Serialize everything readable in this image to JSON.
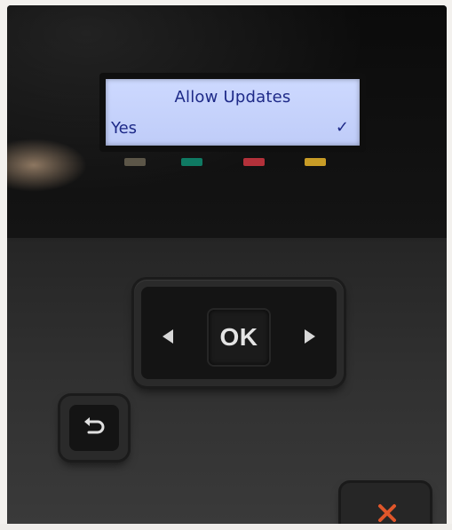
{
  "display": {
    "title": "Allow Updates",
    "option_label": "Yes",
    "option_selected_mark": "✓"
  },
  "buttons": {
    "ok_label": "OK",
    "left_icon": "left-arrow-icon",
    "right_icon": "right-arrow-icon",
    "back_icon": "back-arrow-icon",
    "cancel_icon": "close-icon"
  },
  "colors": {
    "lcd_background": "#c6d3fc",
    "lcd_text": "#1e2a88",
    "led_1": "#5c5648",
    "led_2": "#0f7a63",
    "led_3": "#b3313a",
    "led_4": "#c89c26",
    "cancel_icon": "#e0562a"
  }
}
